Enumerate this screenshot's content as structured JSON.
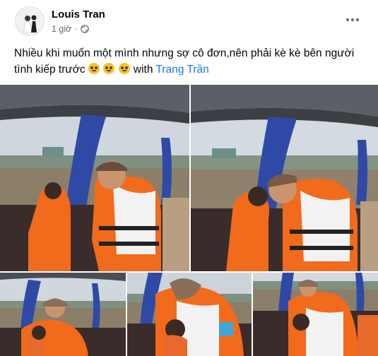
{
  "post": {
    "author": "Louis Tran",
    "time": "1 giờ",
    "separator": "·",
    "caption_text": "Nhiều khi muốn một mình nhưng sợ cô đơn,nên phải kè kè bên người tình kiếp trước",
    "with_text": "with",
    "tagged_user": "Trang Trần",
    "emoji_count": 3
  },
  "icons": {
    "privacy": "globe-icon",
    "options": "more-horizontal-icon"
  },
  "colors": {
    "link": "#1877f2",
    "secondary_text": "#65676b",
    "life_jacket": "#f26a1b",
    "curtain": "#2f4aa6"
  },
  "photos": [
    {
      "id": "photo-1"
    },
    {
      "id": "photo-2"
    },
    {
      "id": "photo-3"
    },
    {
      "id": "photo-4"
    },
    {
      "id": "photo-5"
    }
  ]
}
